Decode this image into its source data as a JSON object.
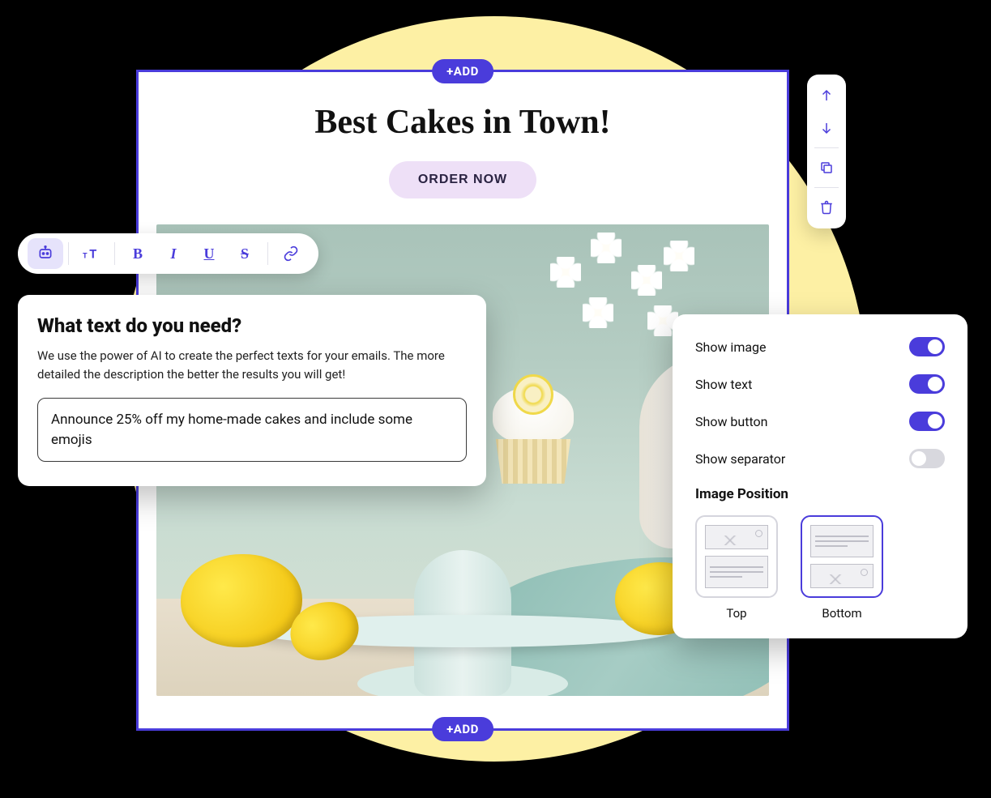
{
  "editor": {
    "add_label": "+ADD",
    "hero_title": "Best Cakes in Town!",
    "cta_label": "ORDER NOW"
  },
  "toolbar": {
    "ai": "ai-icon",
    "size": "text-size-icon",
    "bold": "B",
    "italic": "I",
    "underline": "U",
    "strike": "S",
    "link": "link-icon"
  },
  "ai": {
    "title": "What text do you need?",
    "description": "We use the power of AI to create the perfect texts for your emails. The more detailed the description the better the results you will get!",
    "input_value": "Announce 25% off my home-made cakes and include some emojis"
  },
  "actions": {
    "up": "arrow-up-icon",
    "down": "arrow-down-icon",
    "copy": "copy-icon",
    "delete": "trash-icon"
  },
  "settings": {
    "items": [
      {
        "label": "Show image",
        "on": true
      },
      {
        "label": "Show text",
        "on": true
      },
      {
        "label": "Show button",
        "on": true
      },
      {
        "label": "Show separator",
        "on": false
      }
    ],
    "image_position_label": "Image Position",
    "positions": [
      {
        "label": "Top",
        "selected": false
      },
      {
        "label": "Bottom",
        "selected": true
      }
    ]
  },
  "image": {
    "alt": "Lemon cupcakes on a pale cake stand with lemons, white flowers and teal linen"
  }
}
